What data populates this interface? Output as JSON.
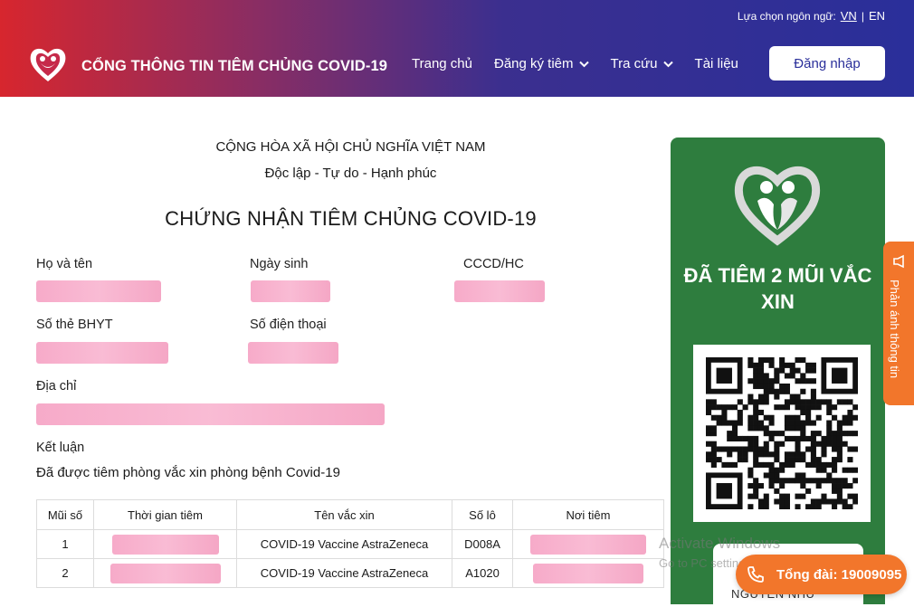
{
  "header": {
    "lang_label": "Lựa chọn ngôn ngữ:",
    "lang_vn": "VN",
    "lang_sep": "|",
    "lang_en": "EN",
    "site_title": "CỔNG THÔNG TIN TIÊM CHỦNG COVID-19",
    "nav": {
      "home": "Trang chủ",
      "register": "Đăng ký tiêm",
      "lookup": "Tra cứu",
      "docs": "Tài liệu"
    },
    "login": "Đăng nhập"
  },
  "certificate": {
    "nation": "CỘNG HÒA XÃ HỘI CHỦ NGHĨA VIỆT NAM",
    "motto": "Độc lập - Tự do - Hạnh phúc",
    "title": "CHỨNG NHẬN TIÊM CHỦNG COVID-19",
    "fields": {
      "name_label": "Họ và tên",
      "dob_label": "Ngày sinh",
      "id_label": "CCCD/HC",
      "insurance_label": "Số thẻ BHYT",
      "phone_label": "Số điện thoại",
      "address_label": "Địa chỉ",
      "conclusion_label": "Kết luận"
    },
    "conclusion": "Đã được tiêm phòng vắc xin phòng bệnh Covid-19",
    "table": {
      "headers": [
        "Mũi số",
        "Thời gian tiêm",
        "Tên vắc xin",
        "Số lô",
        "Nơi tiêm"
      ],
      "rows": [
        {
          "dose": "1",
          "vaccine": "COVID-19 Vaccine AstraZeneca",
          "lot": "D008A"
        },
        {
          "dose": "2",
          "vaccine": "COVID-19 Vaccine AstraZeneca",
          "lot": "A1020"
        }
      ]
    }
  },
  "sidebar": {
    "status": "ĐÃ TIÊM 2 MŨI VẮC XIN",
    "owner_name": "NGUYEN NHU",
    "bg_color": "#2e7d3e"
  },
  "feedback": {
    "label": "Phản ánh thông tin",
    "color": "#f2762b"
  },
  "watermark": {
    "line1": "Activate Windows",
    "line2": "Go to PC settings to activate Windows."
  },
  "hotline": {
    "label": "Tổng đài: 19009095"
  }
}
